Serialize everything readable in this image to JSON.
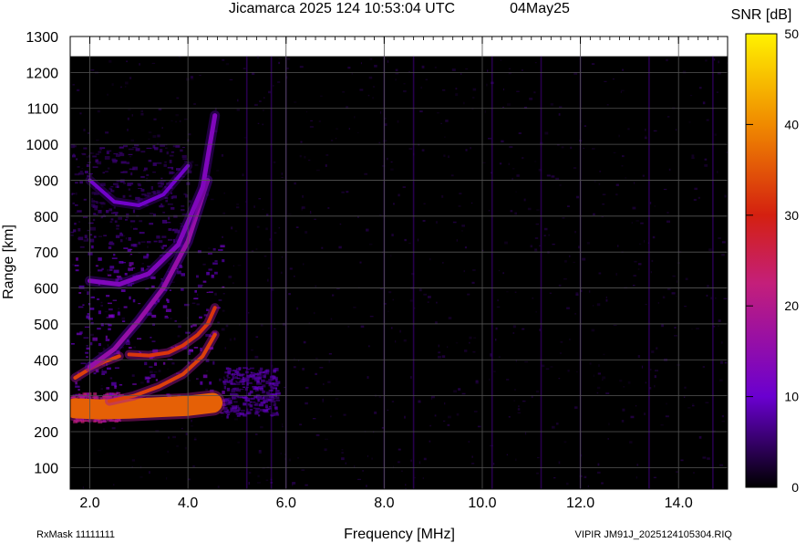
{
  "chart_data": {
    "type": "heatmap",
    "title": "Jicamarca 2025 124 10:53:04 UTC",
    "date_label": "04May25",
    "xlabel": "Frequency [MHz]",
    "ylabel": "Range [km]",
    "xlim": [
      1.6,
      15.0
    ],
    "ylim": [
      40,
      1300
    ],
    "x_ticks": [
      {
        "value": 2,
        "label": "2.0"
      },
      {
        "value": 4,
        "label": "4.0"
      },
      {
        "value": 6,
        "label": "6.0"
      },
      {
        "value": 8,
        "label": "8.0"
      },
      {
        "value": 10,
        "label": "10.0"
      },
      {
        "value": 12,
        "label": "12.0"
      },
      {
        "value": 14,
        "label": "14.0"
      }
    ],
    "y_ticks": [
      {
        "value": 100,
        "label": "100"
      },
      {
        "value": 200,
        "label": "200"
      },
      {
        "value": 300,
        "label": "300"
      },
      {
        "value": 400,
        "label": "400"
      },
      {
        "value": 500,
        "label": "500"
      },
      {
        "value": 600,
        "label": "600"
      },
      {
        "value": 700,
        "label": "700"
      },
      {
        "value": 800,
        "label": "800"
      },
      {
        "value": 900,
        "label": "900"
      },
      {
        "value": 1000,
        "label": "1000"
      },
      {
        "value": 1100,
        "label": "1100"
      },
      {
        "value": 1200,
        "label": "1200"
      },
      {
        "value": 1300,
        "label": "1300"
      }
    ],
    "grid": true,
    "colorbar": {
      "label": "SNR [dB]",
      "range": [
        0,
        50
      ],
      "ticks": [
        {
          "value": 0,
          "label": "0"
        },
        {
          "value": 10,
          "label": "10"
        },
        {
          "value": 20,
          "label": "20"
        },
        {
          "value": 30,
          "label": "30"
        },
        {
          "value": 40,
          "label": "40"
        },
        {
          "value": 50,
          "label": "50"
        }
      ]
    },
    "data_top_range_km": 1245,
    "traces": [
      {
        "f": [
          1.7,
          2.2,
          2.8,
          3.4,
          4.0,
          4.5
        ],
        "r": [
          265,
          262,
          264,
          268,
          272,
          280
        ],
        "snr": 36,
        "width": 22
      },
      {
        "f": [
          1.7,
          2.0,
          2.3,
          2.6
        ],
        "r": [
          350,
          375,
          395,
          410
        ],
        "snr": 33,
        "width": 4
      },
      {
        "f": [
          2.4,
          2.9,
          3.4,
          3.9,
          4.3,
          4.55
        ],
        "r": [
          285,
          300,
          325,
          360,
          410,
          470
        ],
        "snr": 33,
        "width": 4
      },
      {
        "f": [
          2.8,
          3.2,
          3.6,
          3.9,
          4.2,
          4.4,
          4.55
        ],
        "r": [
          415,
          412,
          420,
          440,
          470,
          500,
          545
        ],
        "snr": 32,
        "width": 4
      },
      {
        "f": [
          2.0,
          2.5,
          3.0,
          3.5,
          4.0,
          4.4
        ],
        "r": [
          380,
          430,
          510,
          600,
          730,
          900
        ],
        "snr": 16,
        "width": 5
      },
      {
        "f": [
          2.0,
          2.6,
          3.2,
          3.8,
          4.3,
          4.55
        ],
        "r": [
          620,
          610,
          640,
          720,
          880,
          1080
        ],
        "snr": 13,
        "width": 5
      },
      {
        "f": [
          2.0,
          2.5,
          3.0,
          3.5,
          4.0
        ],
        "r": [
          900,
          840,
          830,
          860,
          940
        ],
        "snr": 11,
        "width": 4
      }
    ],
    "blobs": [
      {
        "f": [
          1.6,
          4.7
        ],
        "r": [
          250,
          720
        ],
        "snr": 11
      },
      {
        "f": [
          4.7,
          5.8
        ],
        "r": [
          245,
          380
        ],
        "snr": 8
      },
      {
        "f": [
          1.6,
          2.6
        ],
        "r": [
          230,
          310
        ],
        "snr": 20
      },
      {
        "f": [
          1.6,
          4.0
        ],
        "r": [
          720,
          1000
        ],
        "snr": 6
      }
    ],
    "vertical_stripes_mhz": [
      5.2,
      5.7,
      6.0,
      8.0,
      8.6,
      10.2,
      11.2,
      12.0,
      13.4,
      14.7
    ],
    "noise_floor_snr": 1.5
  },
  "footer": {
    "left": "RxMask 11111111",
    "right": "VIPIR  JM91J_2025124105304.RIQ"
  }
}
